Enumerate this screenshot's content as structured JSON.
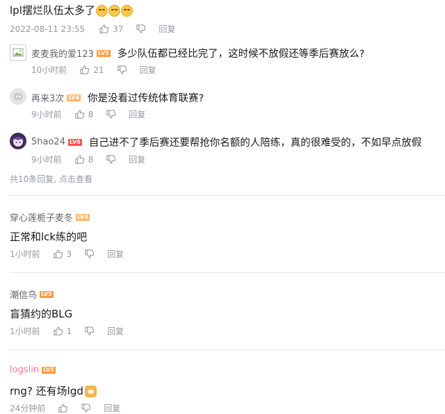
{
  "root_comment": {
    "text": "lpl摆烂队伍太多了",
    "emoji_names": [
      "laugh-cry-emoji",
      "laugh-cry-emoji",
      "laugh-cry-emoji"
    ],
    "time": "2022-08-11 23:55",
    "likes": "37",
    "reply_label": "回复"
  },
  "replies": [
    {
      "user": "麦麦我的爱123",
      "level": "LV5",
      "text": "多少队伍都已经比完了，这时候不放假还等季后赛放么?",
      "time": "10小时前",
      "likes": "21",
      "reply_label": "回复"
    },
    {
      "user": "再来3次",
      "level": "LV4",
      "text": "你是没看过传统体育联赛?",
      "time": "9小时前",
      "likes": "8",
      "reply_label": "回复"
    },
    {
      "user": "5hao24",
      "level": "LV6",
      "text": "自己进不了季后赛还要帮抢你名额的人陪练，真的很难受的，不如早点放假",
      "time": "9小时前",
      "likes": "8",
      "reply_label": "回复"
    }
  ],
  "more_replies": "共10条回复, 点击查看",
  "comments": [
    {
      "user": "穿心莲栀子麦冬",
      "level": "LV4",
      "text": "正常和lck练的吧",
      "time": "1小时前",
      "likes": "3",
      "reply_label": "回复"
    },
    {
      "user": "潮信鸟",
      "level": "LV5",
      "text": "盲猜约的BLG",
      "time": "1小时前",
      "likes": "1",
      "reply_label": "回复"
    },
    {
      "user": "logslin",
      "level": "LV5",
      "text": "rng? 还有场lgd",
      "time": "24分钟前",
      "likes": "",
      "reply_label": "回复"
    }
  ],
  "colors": {
    "meta": "#9499a0",
    "username": "#61666d",
    "vip_username": "#fb7299",
    "divider": "#e3e5e7"
  }
}
